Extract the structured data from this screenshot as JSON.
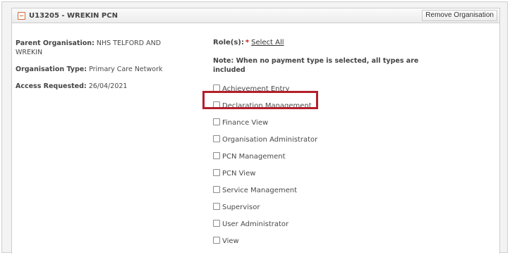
{
  "organisation": {
    "code_title": "U13205 - WREKIN PCN",
    "remove_label": "Remove Organisation"
  },
  "details": {
    "parent_label": "Parent Organisation:",
    "parent_value": "NHS TELFORD AND WREKIN",
    "type_label": "Organisation Type:",
    "type_value": "Primary Care Network",
    "access_label": "Access Requested:",
    "access_value": "26/04/2021"
  },
  "roles": {
    "label": "Role(s):",
    "required_marker": "*",
    "select_all": "Select All",
    "note": "Note: When no payment type is selected, all types are included",
    "items": [
      {
        "label": "Achievement Entry",
        "checked": false
      },
      {
        "label": "Declaration Management",
        "checked": false,
        "highlighted": true
      },
      {
        "label": "Finance View",
        "checked": false
      },
      {
        "label": "Organisation Administrator",
        "checked": false
      },
      {
        "label": "PCN Management",
        "checked": false
      },
      {
        "label": "PCN View",
        "checked": false
      },
      {
        "label": "Service Management",
        "checked": false
      },
      {
        "label": "Supervisor",
        "checked": false
      },
      {
        "label": "User Administrator",
        "checked": false
      },
      {
        "label": "View",
        "checked": false
      }
    ]
  },
  "colors": {
    "highlight_border": "#b3202a",
    "toggle_accent": "#d16a3a",
    "required_marker": "#d11a1a"
  }
}
